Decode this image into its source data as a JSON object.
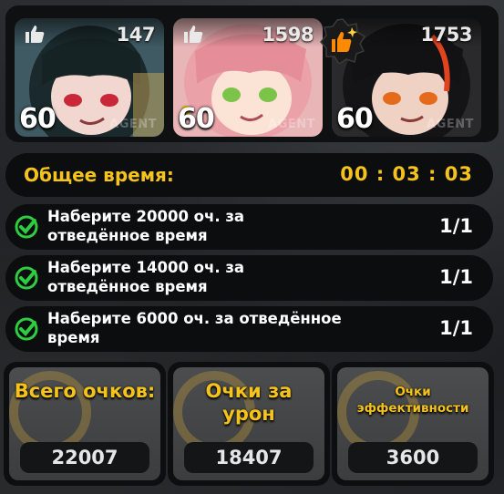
{
  "agents": [
    {
      "likes": "147",
      "level": "60",
      "tag": "AGENT",
      "portrait": "agent-portrait-dark-hair-red-eyes"
    },
    {
      "likes": "1598",
      "level": "60",
      "tag": "AGENT",
      "portrait": "agent-portrait-pink-hair-green-eyes"
    },
    {
      "likes": "1753",
      "level": "60",
      "tag": "AGENT",
      "portrait": "agent-portrait-black-red-hair",
      "top_liked": true
    }
  ],
  "time": {
    "label": "Общее время:",
    "value": "00 : 03 : 03"
  },
  "tasks": [
    {
      "text": "Наберите 20000 оч. за отведённое время",
      "count": "1/1",
      "status": "complete"
    },
    {
      "text": "Наберите 14000 оч. за отведённое время",
      "count": "1/1",
      "status": "complete"
    },
    {
      "text": "Наберите 6000 оч. за отведённое время",
      "count": "1/1",
      "status": "complete"
    }
  ],
  "stats": [
    {
      "label": "Всего очков:",
      "value": "22007"
    },
    {
      "label": "Очки за урон",
      "value": "18407"
    },
    {
      "label": "Очки эффективности",
      "value": "3600"
    }
  ],
  "colors": {
    "accent": "#f5c31c",
    "check": "#2ecc40",
    "badge": "#ff7a00",
    "panel": "#0c0d0f"
  }
}
